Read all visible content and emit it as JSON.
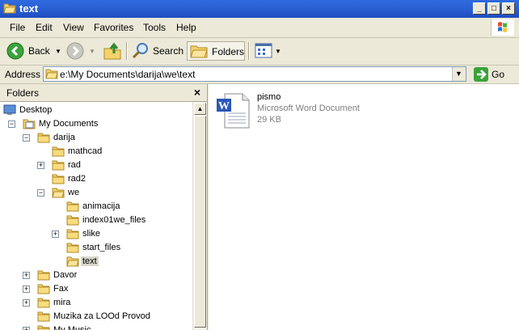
{
  "window": {
    "title": "text"
  },
  "menu": [
    "File",
    "Edit",
    "View",
    "Favorites",
    "Tools",
    "Help"
  ],
  "toolbar": {
    "back": "Back",
    "search": "Search",
    "folders": "Folders"
  },
  "address": {
    "label": "Address",
    "path": "e:\\My Documents\\darija\\we\\text",
    "go": "Go"
  },
  "folders_pane": {
    "title": "Folders",
    "close": "×",
    "tree": [
      {
        "label": "Desktop",
        "level": 0,
        "expander": "",
        "icon": "desktop-icon"
      },
      {
        "label": "My Documents",
        "level": 1,
        "expander": "−",
        "icon": "my-documents-icon"
      },
      {
        "label": "darija",
        "level": 2,
        "expander": "−",
        "icon": "folder-icon"
      },
      {
        "label": "mathcad",
        "level": 3,
        "expander": "",
        "icon": "folder-icon"
      },
      {
        "label": "rad",
        "level": 3,
        "expander": "+",
        "icon": "folder-icon"
      },
      {
        "label": "rad2",
        "level": 3,
        "expander": "",
        "icon": "folder-icon"
      },
      {
        "label": "we",
        "level": 3,
        "expander": "−",
        "icon": "folder-open-icon"
      },
      {
        "label": "animacija",
        "level": 4,
        "expander": "",
        "icon": "folder-icon"
      },
      {
        "label": "index01we_files",
        "level": 4,
        "expander": "",
        "icon": "folder-icon"
      },
      {
        "label": "slike",
        "level": 4,
        "expander": "+",
        "icon": "folder-icon"
      },
      {
        "label": "start_files",
        "level": 4,
        "expander": "",
        "icon": "folder-icon"
      },
      {
        "label": "text",
        "level": 4,
        "expander": "",
        "icon": "folder-open-icon",
        "selected": true
      },
      {
        "label": "Davor",
        "level": 2,
        "expander": "+",
        "icon": "folder-icon"
      },
      {
        "label": "Fax",
        "level": 2,
        "expander": "+",
        "icon": "folder-icon"
      },
      {
        "label": "mira",
        "level": 2,
        "expander": "+",
        "icon": "folder-icon"
      },
      {
        "label": "Muzika za LOOd Provod",
        "level": 2,
        "expander": "",
        "icon": "folder-icon"
      },
      {
        "label": "My Music",
        "level": 2,
        "expander": "+",
        "icon": "folder-icon"
      }
    ]
  },
  "files": [
    {
      "name": "pismo",
      "type": "Microsoft Word Document",
      "size": "29 KB",
      "icon": "word-document-icon"
    }
  ],
  "colors": {
    "titlebar": "#2a60d4",
    "folder": "#f5d36a",
    "word_blue": "#2b57b8"
  }
}
